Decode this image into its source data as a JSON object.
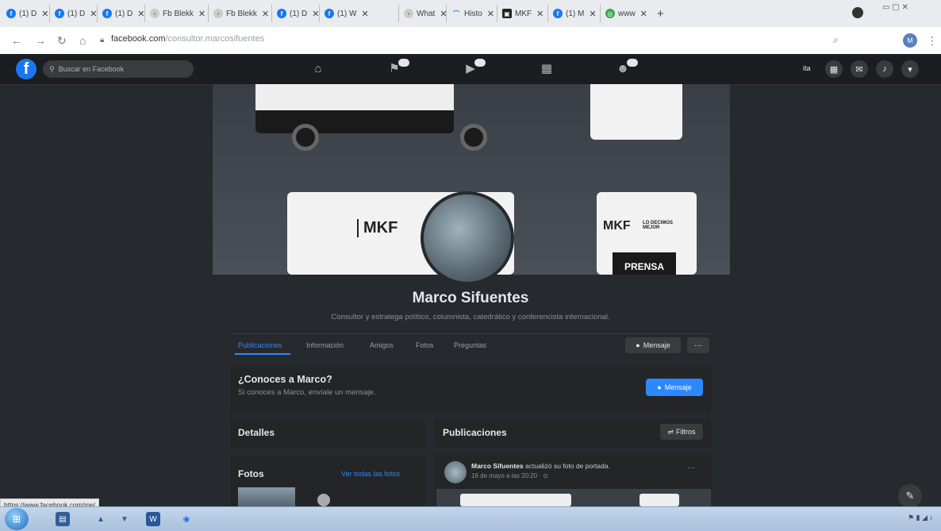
{
  "browser": {
    "tabs": [
      {
        "label": "(1) D",
        "icon": "facebook-icon"
      },
      {
        "label": "(1) D",
        "icon": "facebook-icon"
      },
      {
        "label": "(1) D",
        "icon": "facebook-icon"
      },
      {
        "label": "Fb Blekk",
        "icon": "page-icon"
      },
      {
        "label": "Fb Blekk",
        "icon": "page-icon"
      },
      {
        "label": "(1) D",
        "icon": "facebook-icon"
      },
      {
        "label": "(1) W",
        "icon": "facebook-icon"
      },
      {
        "label": "What",
        "icon": "page-icon"
      },
      {
        "label": "Histo",
        "icon": "history-icon"
      },
      {
        "label": "MKF",
        "icon": "mkf-icon"
      },
      {
        "label": "(1) M",
        "icon": "facebook-icon"
      },
      {
        "label": "www",
        "icon": "globe-icon"
      }
    ],
    "new_tab_label": "+",
    "url_host": "facebook.com",
    "url_path": "/consultor.marcosifuentes",
    "status_url": "https://www.facebook.com/me/"
  },
  "facebook": {
    "search_placeholder": "Buscar en Facebook",
    "user_short": "ita",
    "profile": {
      "name": "Marco Sifuentes",
      "bio": "Consultor y estratega político, columnista, catedrático y conferencista internacional.",
      "tabs": [
        "Publicaciones",
        "Información",
        "Amigos",
        "Fotos",
        "Preguntas"
      ],
      "message_label": "Mensaje",
      "more_label": "···"
    },
    "know_card": {
      "title": "¿Conoces a Marco?",
      "subtitle": "Si conoces a Marco, envíale un mensaje.",
      "button": "Mensaje"
    },
    "details_title": "Detalles",
    "photos_title": "Fotos",
    "see_all_photos": "Ver todas las fotos",
    "posts_title": "Publicaciones",
    "filters_label": "Filtros",
    "post": {
      "author": "Marco Sifuentes",
      "action": "actualizó su foto de portada.",
      "date": "16 de mayo a las 20:20 · ⊙",
      "more": "···"
    },
    "cover_texts": {
      "brand": "MKF",
      "slogan": "LO DECIMOS MEJOR",
      "press": "PRENSA"
    }
  },
  "colors": {
    "fb_blue": "#1877f2",
    "dark_bg": "#26292e",
    "card_bg": "#242526",
    "text_primary": "#e4e6eb"
  }
}
